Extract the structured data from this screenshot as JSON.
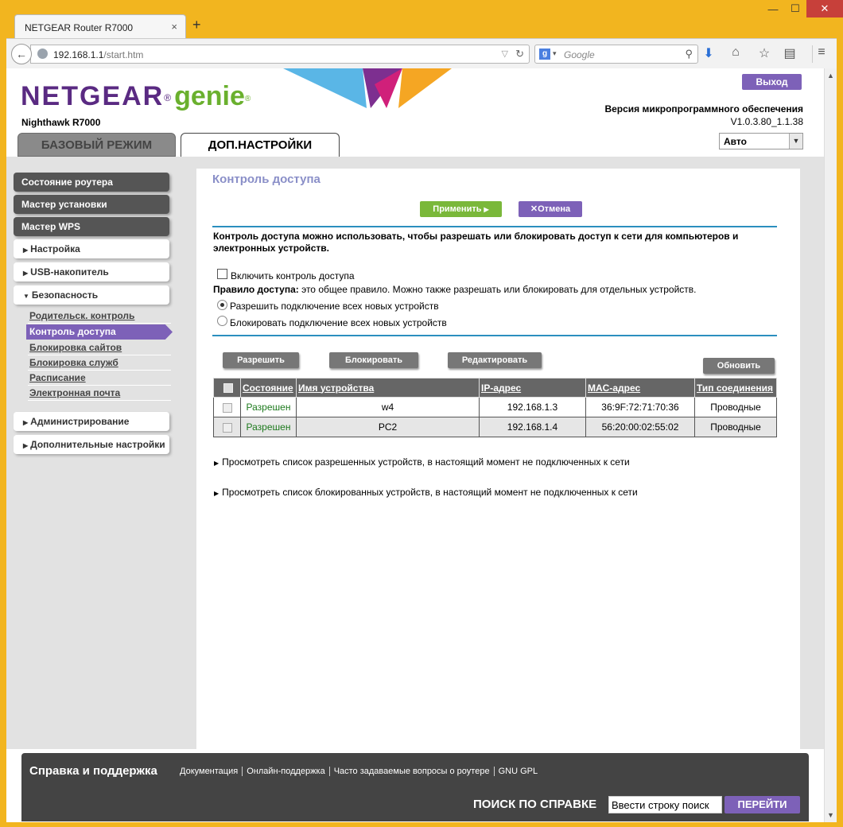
{
  "browser": {
    "tab_title": "NETGEAR Router R7000",
    "tab_close": "×",
    "new_tab": "+",
    "url_host": "192.168.1.1",
    "url_path": "/start.htm",
    "search_engine": "g",
    "search_placeholder": "Google",
    "win_min": "—",
    "win_max": "☐",
    "win_close": "✕"
  },
  "header": {
    "logo_brand": "NETGEAR",
    "logo_reg": "®",
    "logo_product": "genie",
    "logo_tm": "®",
    "model": "Nighthawk R7000",
    "logout": "Выход",
    "firmware_label": "Версия микропрограммного обеспечения",
    "firmware_version": "V1.0.3.80_1.1.38",
    "tab_basic": "БАЗОВЫЙ РЕЖИМ",
    "tab_advanced": "ДОП.НАСТРОЙКИ",
    "language": "Авто"
  },
  "sidebar": {
    "router_status": "Состояние роутера",
    "setup_wizard": "Мастер установки",
    "wps_wizard": "Мастер WPS",
    "setup": "Настройка",
    "usb": "USB-накопитель",
    "security": "Безопасность",
    "security_items": [
      "Родительск. контроль",
      "Контроль доступа",
      "Блокировка сайтов",
      "Блокировка служб",
      "Расписание",
      "Электронная почта"
    ],
    "administration": "Администрирование",
    "advanced_setup": "Дополнительные настройки"
  },
  "main": {
    "title": "Контроль доступа",
    "apply": "Применить",
    "cancel": "Отмена",
    "description": "Контроль доступа можно использовать, чтобы разрешать или блокировать доступ к сети для компьютеров и электронных устройств.",
    "enable_label": "Включить контроль доступа",
    "rule_bold": "Правило доступа:",
    "rule_text": " это общее правило. Можно также разрешать или блокировать для отдельных устройств.",
    "radio_allow": "Разрешить подключение всех новых устройств",
    "radio_block": "Блокировать подключение всех новых устройств",
    "btn_allow": "Разрешить",
    "btn_block": "Блокировать",
    "btn_edit": "Редактировать",
    "btn_refresh": "Обновить",
    "table": {
      "headers": [
        "Состояние",
        "Имя устройства",
        "IP-адрес",
        "MAC-адрес",
        "Тип соединения"
      ],
      "rows": [
        [
          "Разрешен",
          "w4",
          "192.168.1.3",
          "36:9F:72:71:70:36",
          "Проводные"
        ],
        [
          "Разрешен",
          "PC2",
          "192.168.1.4",
          "56:20:00:02:55:02",
          "Проводные"
        ]
      ]
    },
    "link_allowed": "Просмотреть список разрешенных устройств, в настоящий момент не подключенных к сети",
    "link_blocked": "Просмотреть список блокированных устройств, в настоящий момент не подключенных к сети"
  },
  "footer": {
    "title": "Справка и поддержка",
    "links": [
      "Документация",
      "Онлайн-поддержка",
      "Часто задаваемые вопросы о роутере",
      "GNU GPL"
    ],
    "search_label": "ПОИСК ПО СПРАВКЕ",
    "search_value": "Ввести строку поиск",
    "go": "ПЕРЕЙТИ"
  },
  "colors": {
    "brand_purple": "#5a2a82",
    "genie_green": "#6ab02e",
    "accent_purple": "#7d61b8",
    "apply_green": "#7ab83a",
    "rule_blue": "#2b8fbf",
    "allowed_green": "#1d7a1d"
  }
}
